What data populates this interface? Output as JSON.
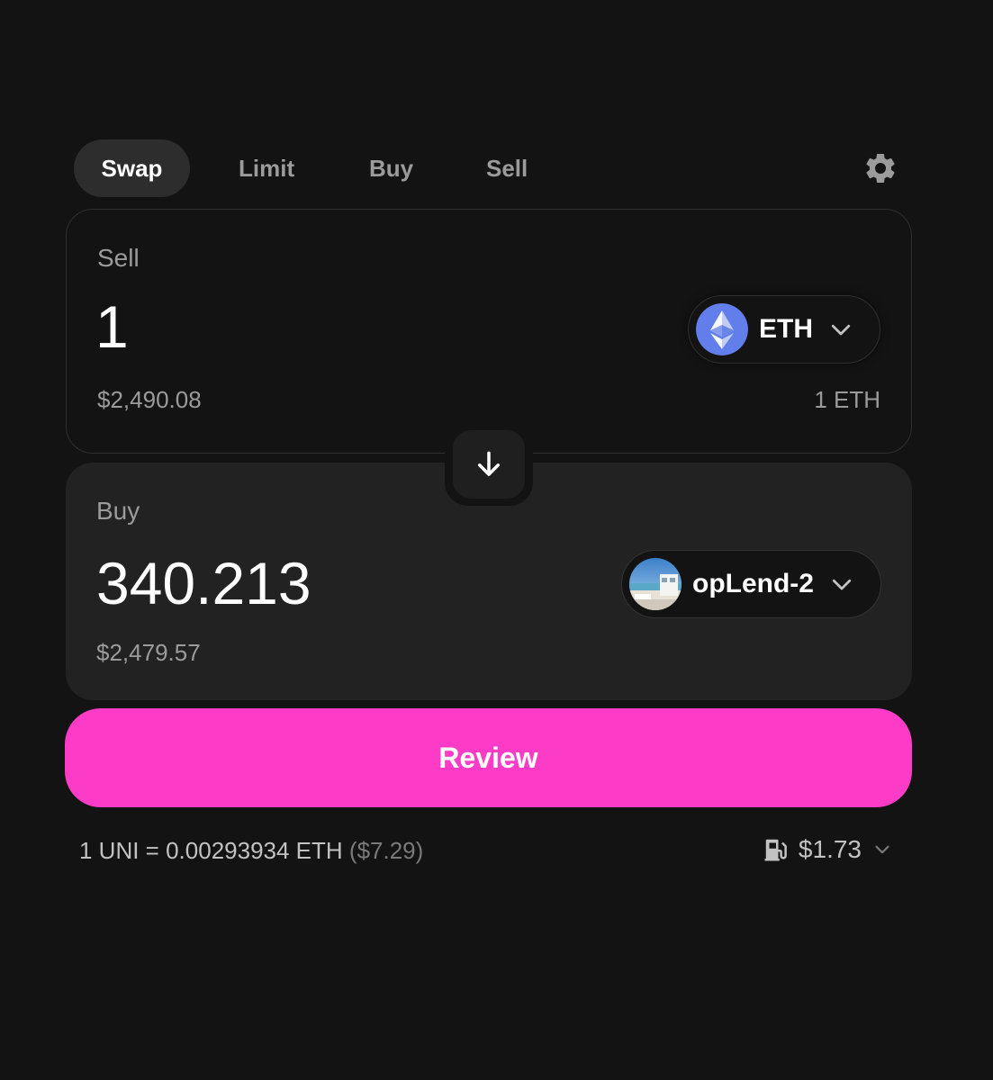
{
  "tabs": [
    {
      "label": "Swap",
      "active": true
    },
    {
      "label": "Limit",
      "active": false
    },
    {
      "label": "Buy",
      "active": false
    },
    {
      "label": "Sell",
      "active": false
    }
  ],
  "sell": {
    "label": "Sell",
    "amount": "1",
    "usd_value": "$2,490.08",
    "balance": "1 ETH",
    "token": {
      "symbol": "ETH",
      "icon": "ethereum-icon",
      "color": "#627eea"
    }
  },
  "buy": {
    "label": "Buy",
    "amount": "340.213",
    "usd_value": "$2,479.57",
    "token": {
      "symbol": "opLend-2",
      "icon": "oplend-token-image"
    }
  },
  "review_label": "Review",
  "rate": {
    "text": "1 UNI = 0.00293934 ETH",
    "usd": "($7.29)"
  },
  "gas": {
    "value": "$1.73",
    "icon": "gas-pump-icon"
  },
  "colors": {
    "accent": "#fc3bc6",
    "background": "#131313",
    "panel": "#222222"
  }
}
